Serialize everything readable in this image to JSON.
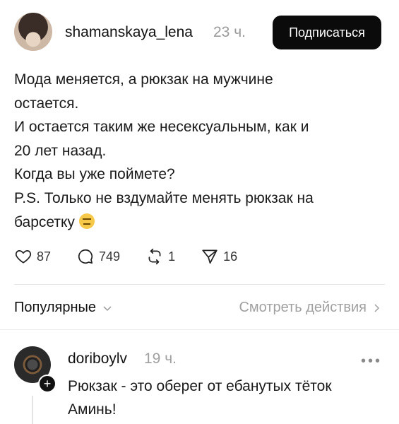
{
  "post": {
    "username": "shamanskaya_lena",
    "time": "23 ч.",
    "follow_label": "Подписаться",
    "text_lines": [
      "Мода меняется, а рюкзак на мужчине",
      "остается.",
      "И остается таким же несексуальным, как и",
      "20 лет назад.",
      "Когда вы уже поймете?",
      "P.S. Только не вздумайте менять рюкзак на",
      "барсетку"
    ],
    "emoji": "expressionless-face",
    "actions": {
      "likes": "87",
      "comments": "749",
      "reposts": "1",
      "shares": "16"
    }
  },
  "sort": {
    "label": "Популярные",
    "activity_label": "Смотреть действия"
  },
  "comment": {
    "username": "doriboylv",
    "time": "19 ч.",
    "text_lines": [
      "Рюкзак - это оберег от ебанутых тёток",
      "Аминь!"
    ],
    "more": "•••"
  }
}
